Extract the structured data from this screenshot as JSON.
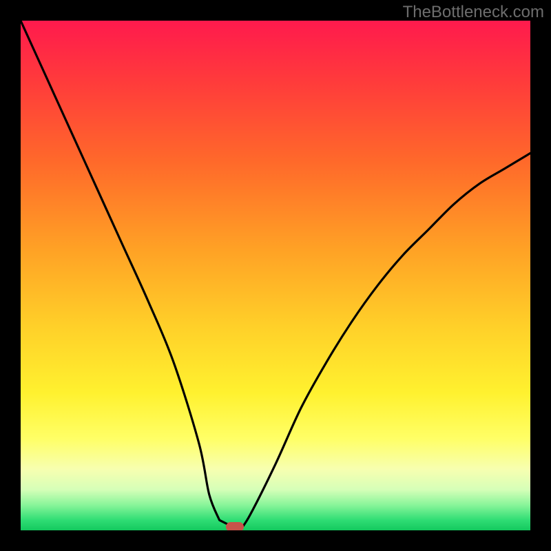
{
  "watermark": "TheBottleneck.com",
  "colors": {
    "frame": "#000000",
    "curve": "#000000",
    "marker": "#c9534a"
  },
  "chart_data": {
    "type": "line",
    "title": "",
    "xlabel": "",
    "ylabel": "",
    "xlim": [
      0,
      100
    ],
    "ylim": [
      0,
      100
    ],
    "grid": false,
    "series": [
      {
        "name": "bottleneck-curve",
        "x": [
          0,
          5,
          10,
          15,
          20,
          25,
          30,
          35,
          37,
          39,
          41,
          43,
          45,
          50,
          55,
          60,
          65,
          70,
          75,
          80,
          85,
          90,
          95,
          100
        ],
        "y": [
          100,
          89,
          78,
          67,
          56,
          45,
          33,
          17,
          7,
          2,
          0,
          0,
          3,
          13,
          24,
          33,
          41,
          48,
          54,
          59,
          64,
          68,
          71,
          74
        ]
      }
    ],
    "flat_segment": {
      "x0": 39,
      "x1": 43,
      "y": 0
    },
    "marker": {
      "x": 42,
      "y": 0.7
    }
  }
}
